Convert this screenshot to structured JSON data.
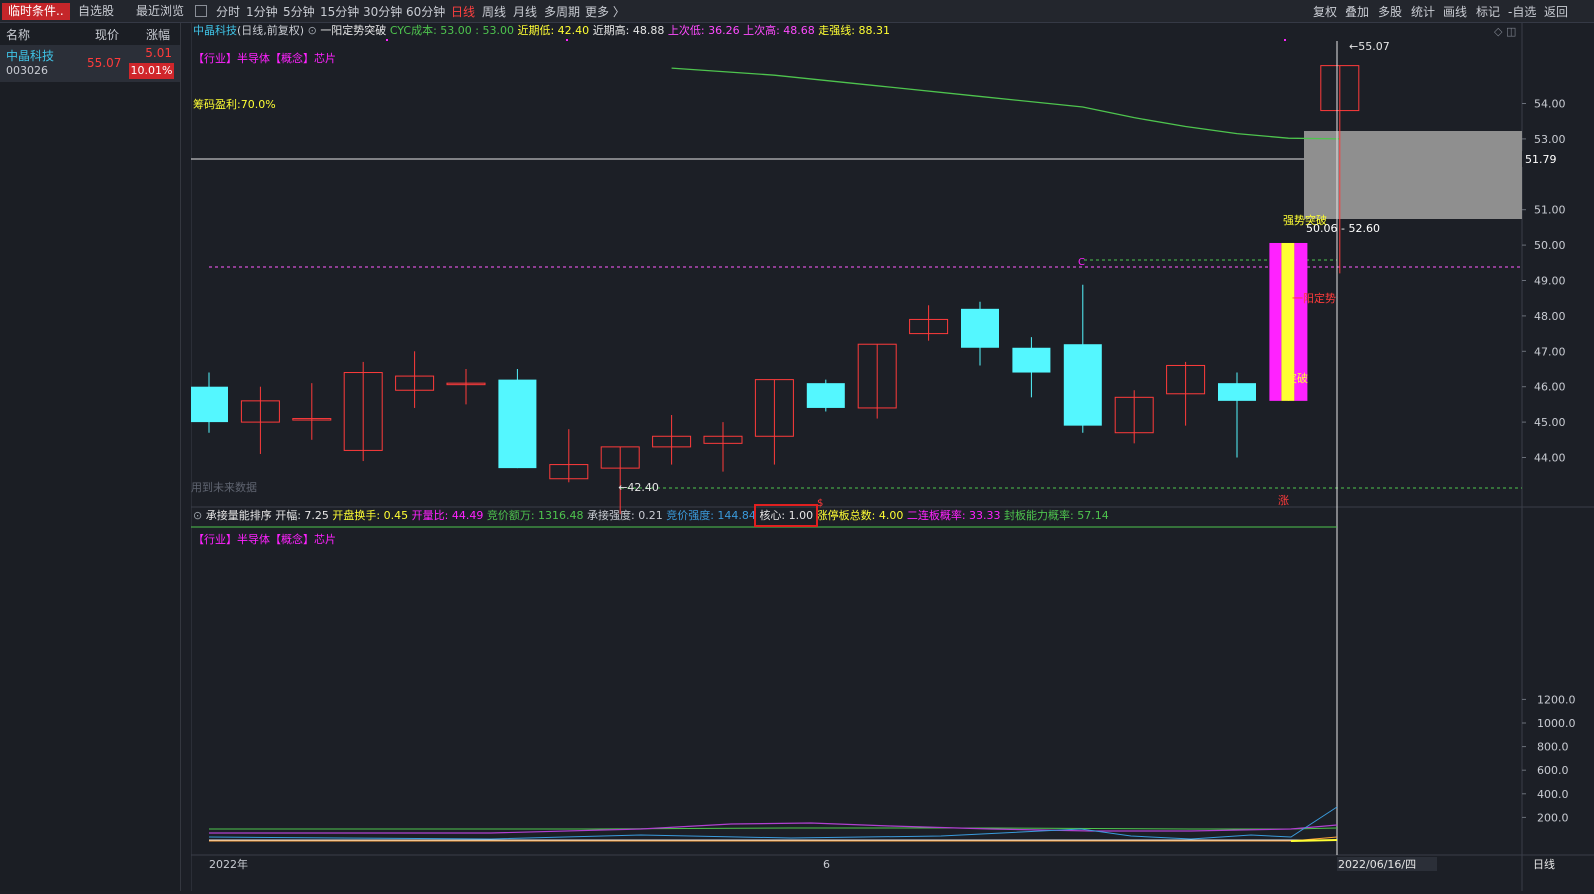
{
  "tabs_left": [
    {
      "label": "临时条件..",
      "active": true
    },
    {
      "label": "自选股",
      "active": false
    },
    {
      "label": "最近浏览",
      "active": false
    }
  ],
  "periods": [
    {
      "label": "分时",
      "active": false
    },
    {
      "label": "1分钟",
      "active": false
    },
    {
      "label": "5分钟",
      "active": false
    },
    {
      "label": "15分钟",
      "active": false
    },
    {
      "label": "30分钟",
      "active": false
    },
    {
      "label": "60分钟",
      "active": false
    },
    {
      "label": "日线",
      "active": true
    },
    {
      "label": "周线",
      "active": false
    },
    {
      "label": "月线",
      "active": false
    },
    {
      "label": "多周期",
      "active": false
    },
    {
      "label": "更多 〉",
      "active": false
    }
  ],
  "tools_right": [
    "复权",
    "叠加",
    "多股",
    "统计",
    "画线",
    "标记",
    "-自选",
    "返回"
  ],
  "list": {
    "headers": {
      "name": "名称",
      "price": "现价",
      "change": "涨幅"
    },
    "rows": [
      {
        "name": "中晶科技",
        "code": "003026",
        "price": "55.07",
        "change_abs": "5.01",
        "change_pct": "10.01%"
      }
    ]
  },
  "main_title": {
    "stock": "中晶科技",
    "period": "(日线,前复权)",
    "indicator": "一阳定势突破",
    "cyc": "CYC成本: 53.00 : 53.00",
    "recent_low": "近期低: 42.40",
    "recent_high": "近期高: 48.88",
    "prev_low": "上次低: 36.26",
    "prev_high": "上次高: 48.68",
    "strong_line": "走强线: 88.31"
  },
  "tags": {
    "industry": "【行业】半导体【概念】芯片"
  },
  "chip_profit": "筹码盈利:70.0%",
  "future_data_note": "用到未来数据",
  "signals": {
    "breakout_top": "强势突破",
    "yiyang": "一阳定势",
    "tupo": "突破",
    "zhang": "涨"
  },
  "price_labels": {
    "high": "55.07",
    "cursor": "51.79",
    "low_label": "42.40",
    "range": "50.06 - 52.60"
  },
  "sub_title": {
    "name": "承接量能排序",
    "amplitude": "开幅: 7.25",
    "open_turnover": "开盘换手: 0.45",
    "open_vol_ratio": "开量比: 44.49",
    "auction_amount": "竞价额万: 1316.48",
    "accept_strength": "承接强度: 0.21",
    "auction_strength": "竞价强度: 144.84",
    "core": "核心: 1.00",
    "limit_total": "涨停板总数: 4.00",
    "second_board_prob": "二连板概率: 33.33",
    "seal_prob": "封板能力概率: 57.14"
  },
  "sub_tags": "【行业】半导体【概念】芯片",
  "bottom_axis": {
    "year": "2022年",
    "mid": "6",
    "cursor_date": "2022/06/16/四",
    "period": "日线"
  },
  "colors": {
    "up": "#ff3b3b",
    "down": "#54f7ff",
    "magenta": "#ff22ff",
    "yellow": "#ffff33",
    "green": "#4ec44e",
    "orange": "#ffa23a",
    "blue": "#3a9bdc"
  },
  "chart_data": {
    "type": "candlestick",
    "price_axis_ticks": [
      54.0,
      53.0,
      51.0,
      50.0,
      49.0,
      48.0,
      47.0,
      46.0,
      45.0,
      44.0
    ],
    "volume_axis_ticks": [
      1200.0,
      1000.0,
      800.0,
      600.0,
      400.0,
      200.0
    ],
    "candles": [
      {
        "o": 46.0,
        "c": 45.0,
        "h": 46.4,
        "l": 44.7
      },
      {
        "o": 45.0,
        "c": 45.6,
        "h": 46.0,
        "l": 44.1
      },
      {
        "o": 45.1,
        "c": 45.1,
        "h": 46.1,
        "l": 44.5
      },
      {
        "o": 44.2,
        "c": 46.4,
        "h": 46.7,
        "l": 43.9
      },
      {
        "o": 45.9,
        "c": 46.3,
        "h": 47.0,
        "l": 45.4
      },
      {
        "o": 46.1,
        "c": 46.1,
        "h": 46.5,
        "l": 45.5
      },
      {
        "o": 46.2,
        "c": 43.7,
        "h": 46.5,
        "l": 43.7
      },
      {
        "o": 43.4,
        "c": 43.8,
        "h": 44.8,
        "l": 43.3
      },
      {
        "o": 43.7,
        "c": 44.3,
        "h": 44.3,
        "l": 42.4
      },
      {
        "o": 44.3,
        "c": 44.6,
        "h": 45.2,
        "l": 43.8
      },
      {
        "o": 44.4,
        "c": 44.6,
        "h": 45.0,
        "l": 43.6
      },
      {
        "o": 44.6,
        "c": 46.2,
        "h": 46.2,
        "l": 43.8
      },
      {
        "o": 46.1,
        "c": 45.4,
        "h": 46.2,
        "l": 45.3
      },
      {
        "o": 45.4,
        "c": 47.2,
        "h": 47.2,
        "l": 45.1
      },
      {
        "o": 47.5,
        "c": 47.9,
        "h": 48.3,
        "l": 47.3
      },
      {
        "o": 48.2,
        "c": 47.1,
        "h": 48.4,
        "l": 46.6
      },
      {
        "o": 47.1,
        "c": 46.4,
        "h": 47.4,
        "l": 45.7
      },
      {
        "o": 47.2,
        "c": 44.9,
        "h": 48.88,
        "l": 44.7
      },
      {
        "o": 44.7,
        "c": 45.7,
        "h": 45.9,
        "l": 44.4
      },
      {
        "o": 45.8,
        "c": 46.6,
        "h": 46.7,
        "l": 44.9
      },
      {
        "o": 46.1,
        "c": 45.6,
        "h": 46.4,
        "l": 44.0
      },
      {
        "o": 45.6,
        "c": 50.06,
        "h": 50.06,
        "l": 45.6
      },
      {
        "o": 53.8,
        "c": 55.07,
        "h": 55.07,
        "l": 49.2
      }
    ],
    "cyc_line": [
      {
        "i": 9,
        "v": 55.0
      },
      {
        "i": 11,
        "v": 54.8
      },
      {
        "i": 13,
        "v": 54.5
      },
      {
        "i": 15,
        "v": 54.2
      },
      {
        "i": 17,
        "v": 53.9
      },
      {
        "i": 18,
        "v": 53.6
      },
      {
        "i": 19,
        "v": 53.35
      },
      {
        "i": 20,
        "v": 53.15
      },
      {
        "i": 21,
        "v": 53.02
      },
      {
        "i": 22,
        "v": 53.0
      }
    ]
  }
}
